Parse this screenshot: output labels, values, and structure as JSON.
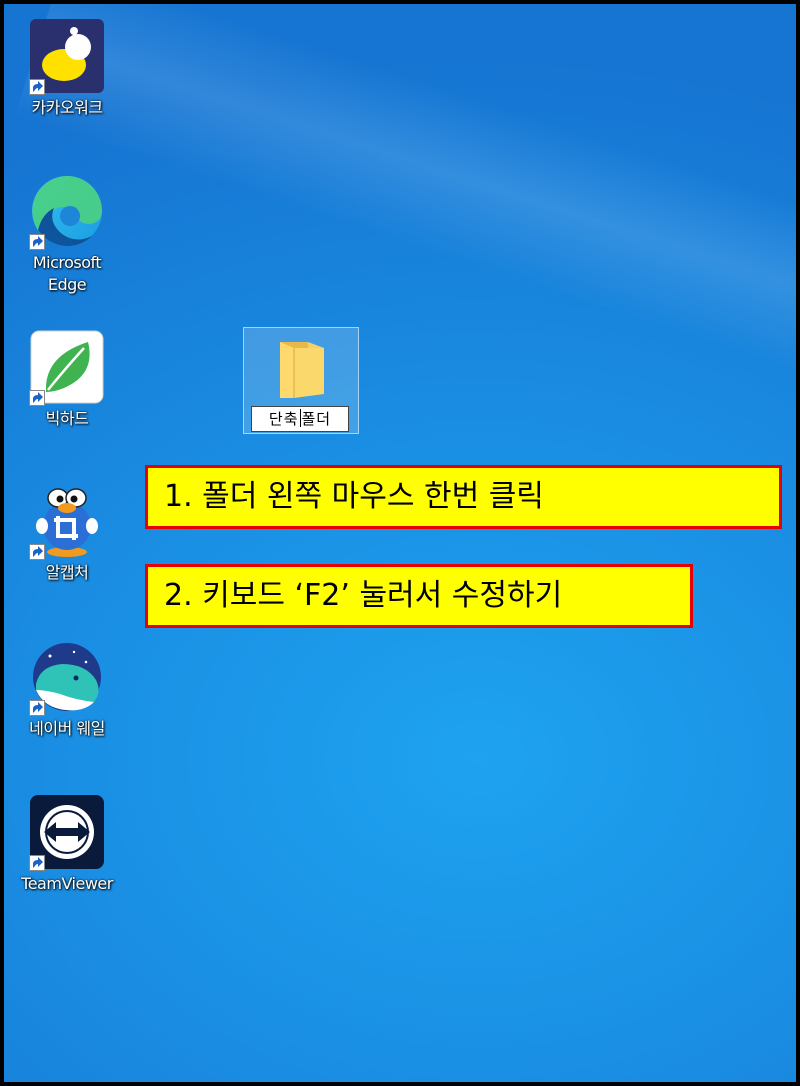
{
  "desktop_icons": [
    {
      "label": "카카오워크",
      "icon": "kakaowork-icon"
    },
    {
      "label": "Microsoft Edge",
      "label_line1": "Microsoft",
      "label_line2": "Edge",
      "icon": "edge-icon"
    },
    {
      "label": "빅하드",
      "icon": "bighard-icon"
    },
    {
      "label": "알캡처",
      "icon": "alcapture-icon"
    },
    {
      "label": "네이버 웨일",
      "icon": "whale-icon"
    },
    {
      "label": "TeamViewer",
      "icon": "teamviewer-icon"
    }
  ],
  "folder": {
    "name_before_caret": "단축",
    "name_after_caret": "폴더",
    "icon": "folder-icon"
  },
  "callouts": [
    {
      "text": "1. 폴더 왼쪽 마우스 한번 클릭"
    },
    {
      "text": "2. 키보드 ‘F2’ 눌러서 수정하기"
    }
  ],
  "colors": {
    "desktop_blue": "#1a8fe3",
    "callout_fill": "#ffff00",
    "callout_border": "#e60000"
  }
}
